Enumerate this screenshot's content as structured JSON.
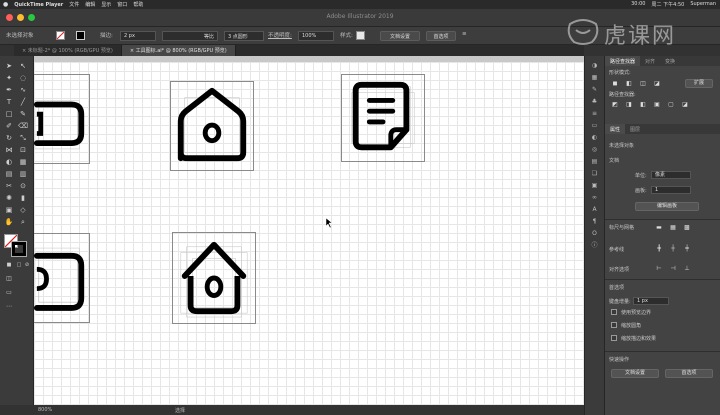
{
  "menubar": {
    "app": "QuickTime Player",
    "items": [
      "文件",
      "编辑",
      "显示",
      "窗口",
      "帮助"
    ],
    "clock": "30:00",
    "date": "周二 下午4:50",
    "user": "Superman"
  },
  "window": {
    "title": "Adobe Illustrator 2019"
  },
  "control": {
    "selection_label": "未选择对象",
    "stroke_label": "描边:",
    "stroke_weight": "2 px",
    "profile_label": "等比",
    "brush_label": "3 点圆形",
    "opacity_label": "不透明度:",
    "opacity_value": "100%",
    "style_label": "样式:",
    "doc_setup_button": "文档设置",
    "preferences_button": "首选项"
  },
  "document_tabs": [
    {
      "label": "未标题-2* @ 100% (RGB/GPU 预览)",
      "active": false
    },
    {
      "label": "工具图标.ai* @ 800% (RGB/GPU 预览)",
      "active": true
    }
  ],
  "status": {
    "zoom": "800%",
    "tool": "选择"
  },
  "panel": {
    "tabs": [
      "路径查找器",
      "对齐",
      "变换"
    ],
    "shape_modes_label": "形状模式:",
    "expand_button": "扩展",
    "pathfinder_label": "路径查找器:",
    "properties_tabs": [
      "属性",
      "图层"
    ],
    "no_selection": "未选择对象",
    "document_label": "文档",
    "units_label": "单位:",
    "units_value": "像素",
    "artboard_label": "画板:",
    "artboard_value": "1",
    "edit_artboards_button": "编辑画板",
    "rulers_label": "标尺与网格",
    "guides_label": "参考线",
    "snap_label": "对齐选项",
    "prefs_label": "首选项",
    "keyboard_increment_label": "键盘增量:",
    "keyboard_increment_value": "1 px",
    "check_1": "使用预览边界",
    "check_2": "缩放圆角",
    "check_3": "缩放描边和效果",
    "quick_actions_label": "快速操作",
    "doc_setup_button": "文档设置",
    "preferences_button": "首选项"
  },
  "watermark": {
    "text": "虎课网"
  },
  "colors": {
    "canvas_bg": "#ffffff",
    "ui_dark": "#3b3b3b",
    "grid": "#e6e6e6"
  }
}
